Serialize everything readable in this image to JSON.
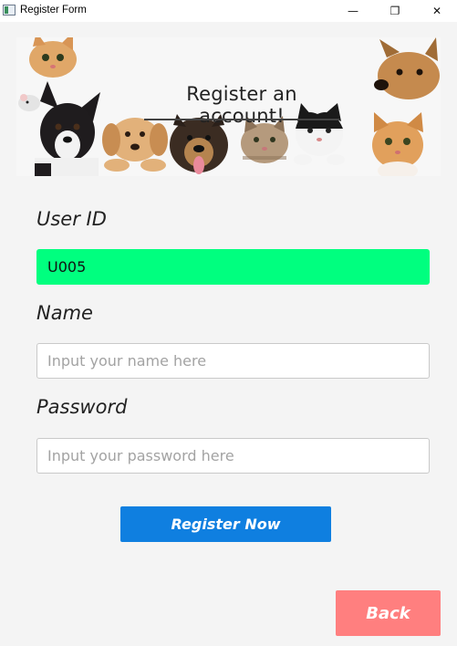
{
  "window": {
    "title": "Register Form",
    "controls": {
      "minimize": "—",
      "maximize": "❐",
      "close": "✕"
    }
  },
  "banner": {
    "headline": "Register an account!"
  },
  "form": {
    "user_id": {
      "label": "User ID",
      "value": "U005",
      "highlight_color": "#00ff7f"
    },
    "name": {
      "label": "Name",
      "value": "",
      "placeholder": "Input your name here"
    },
    "password": {
      "label": "Password",
      "value": "",
      "placeholder": "Input your password here"
    }
  },
  "actions": {
    "register_label": "Register Now",
    "register_color": "#0f7fe0",
    "back_label": "Back",
    "back_color": "#ff7f7f"
  }
}
